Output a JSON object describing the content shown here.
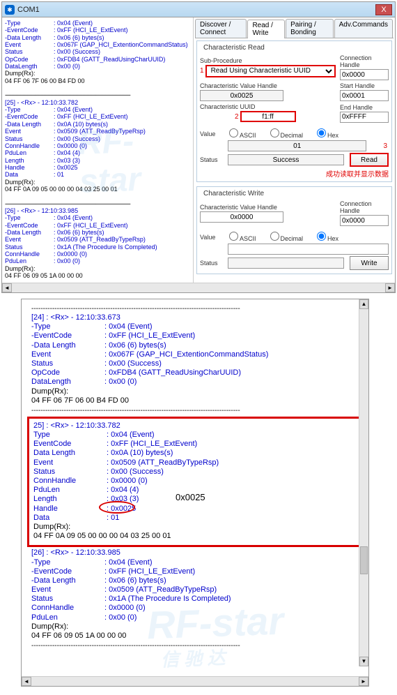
{
  "window": {
    "title": "COM1",
    "close": "X"
  },
  "tabs": {
    "discover": "Discover / Connect",
    "readwrite": "Read / Write",
    "pairing": "Pairing / Bonding",
    "adv": "Adv.Commands"
  },
  "read": {
    "group_title": "Characteristic Read",
    "sub_procedure_label": "Sub-Procedure",
    "sub_procedure_value": "Read Using Characteristic UUID",
    "conn_handle_label": "Connection Handle",
    "conn_handle_value": "0x0000",
    "char_value_handle_label": "Characteristic Value Handle",
    "char_value_handle_value": "0x0025",
    "start_handle_label": "Start Handle",
    "start_handle_value": "0x0001",
    "char_uuid_label": "Characteristic UUID",
    "char_uuid_value": "f1:ff",
    "end_handle_label": "End Handle",
    "end_handle_value": "0xFFFF",
    "value_label": "Value",
    "value_value": "01",
    "status_label": "Status",
    "status_value": "Success",
    "ascii": "ASCII",
    "decimal": "Decimal",
    "hex": "Hex",
    "read_btn": "Read",
    "chinese_note": "成功读取并显示数据"
  },
  "write": {
    "group_title": "Characteristic Write",
    "char_value_handle_label": "Characteristic Value Handle",
    "char_value_handle_value": "0x0000",
    "conn_handle_label": "Connection Handle",
    "conn_handle_value": "0x0000",
    "value_label": "Value",
    "status_label": "Status",
    "ascii": "ASCII",
    "decimal": "Decimal",
    "hex": "Hex",
    "write_btn": "Write"
  },
  "annotations": {
    "a1": "1",
    "a2": "2",
    "a3": "3"
  },
  "log_small": [
    {
      "header": "",
      "rows": [
        [
          "-Type",
          ": 0x04 (Event)"
        ],
        [
          "-EventCode",
          ": 0xFF (HCI_LE_ExtEvent)"
        ],
        [
          "-Data Length",
          ": 0x06 (6) bytes(s)"
        ],
        [
          "Event",
          ": 0x067F (GAP_HCI_ExtentionCommandStatus)"
        ],
        [
          "Status",
          ": 0x00 (Success)"
        ],
        [
          "OpCode",
          ": 0xFDB4 (GATT_ReadUsingCharUUID)"
        ],
        [
          "DataLength",
          ": 0x00 (0)"
        ]
      ],
      "dumplabel": "Dump(Rx):",
      "dump": "04 FF 06 7F 06 00 B4 FD 00"
    },
    {
      "header": "[25] - <Rx> - 12:10:33.782",
      "rows": [
        [
          "-Type",
          ": 0x04 (Event)"
        ],
        [
          "-EventCode",
          ": 0xFF (HCI_LE_ExtEvent)"
        ],
        [
          "-Data Length",
          ": 0x0A (10) bytes(s)"
        ],
        [
          "Event",
          ": 0x0509 (ATT_ReadByTypeRsp)"
        ],
        [
          "Status",
          ": 0x00 (Success)"
        ],
        [
          "ConnHandle",
          ": 0x0000 (0)"
        ],
        [
          "PduLen",
          ": 0x04 (4)"
        ],
        [
          "Length",
          ": 0x03 (3)"
        ],
        [
          "Handle",
          ": 0x0025"
        ],
        [
          "Data",
          ": 01"
        ]
      ],
      "dumplabel": "Dump(Rx):",
      "dump": "04 FF 0A 09 05 00 00 00 04 03 25 00 01"
    },
    {
      "header": "[26] - <Rx> - 12:10:33.985",
      "rows": [
        [
          "-Type",
          ": 0x04 (Event)"
        ],
        [
          "-EventCode",
          ": 0xFF (HCI_LE_ExtEvent)"
        ],
        [
          "-Data Length",
          ": 0x06 (6) bytes(s)"
        ],
        [
          "Event",
          ": 0x0509 (ATT_ReadByTypeRsp)"
        ],
        [
          "Status",
          ": 0x1A (The Procedure Is Completed)"
        ],
        [
          "ConnHandle",
          ": 0x0000 (0)"
        ],
        [
          "PduLen",
          ": 0x00 (0)"
        ]
      ],
      "dumplabel": "Dump(Rx):",
      "dump": "04 FF 06 09 05 1A 00 00 00"
    }
  ],
  "log_doc": {
    "entry24": {
      "header": "[24] : <Rx> - 12:10:33.673",
      "rows": [
        [
          "-Type",
          ": 0x04 (Event)"
        ],
        [
          "-EventCode",
          ": 0xFF (HCI_LE_ExtEvent)"
        ],
        [
          "-Data Length",
          ": 0x06 (6) bytes(s)"
        ],
        [
          " Event",
          ": 0x067F (GAP_HCI_ExtentionCommandStatus)"
        ],
        [
          " Status",
          ": 0x00 (Success)"
        ],
        [
          " OpCode",
          ": 0xFDB4 (GATT_ReadUsingCharUUID)"
        ],
        [
          " DataLength",
          ": 0x00 (0)"
        ]
      ],
      "dumplabel": "Dump(Rx):",
      "dump": "04 FF 06 7F 06 00 B4 FD 00"
    },
    "entry25": {
      "header": "25] : <Rx> - 12:10:33.782",
      "rows": [
        [
          "Type",
          ": 0x04 (Event)"
        ],
        [
          "EventCode",
          ": 0xFF (HCI_LE_ExtEvent)"
        ],
        [
          "Data Length",
          ": 0x0A (10) bytes(s)"
        ],
        [
          "Event",
          ": 0x0509 (ATT_ReadByTypeRsp)"
        ],
        [
          "Status",
          ": 0x00 (Success)"
        ],
        [
          "ConnHandle",
          ": 0x0000 (0)"
        ],
        [
          "PduLen",
          ": 0x04 (4)"
        ],
        [
          "Length",
          ": 0x03 (3)"
        ],
        [
          "Handle",
          ": 0x0025"
        ],
        [
          "Data",
          ": 01"
        ]
      ],
      "dumplabel": "Dump(Rx):",
      "dump": "04 FF 0A 09 05 00 00 00 04 03 25 00 01",
      "annot_handle": "0x0025"
    },
    "entry26": {
      "header": "[26] : <Rx> - 12:10:33.985",
      "rows": [
        [
          "-Type",
          ": 0x04 (Event)"
        ],
        [
          "-EventCode",
          ": 0xFF (HCI_LE_ExtEvent)"
        ],
        [
          "-Data Length",
          ": 0x06 (6) bytes(s)"
        ],
        [
          " Event",
          ": 0x0509 (ATT_ReadByTypeRsp)"
        ],
        [
          " Status",
          ": 0x1A (The Procedure Is Completed)"
        ],
        [
          " ConnHandle",
          ": 0x0000 (0)"
        ],
        [
          " PduLen",
          ": 0x00 (0)"
        ]
      ],
      "dumplabel": "Dump(Rx):",
      "dump": "04 FF 06 09 05 1A 00 00 00"
    }
  },
  "sep_line": "------------------------------------------------------------------------------------------"
}
